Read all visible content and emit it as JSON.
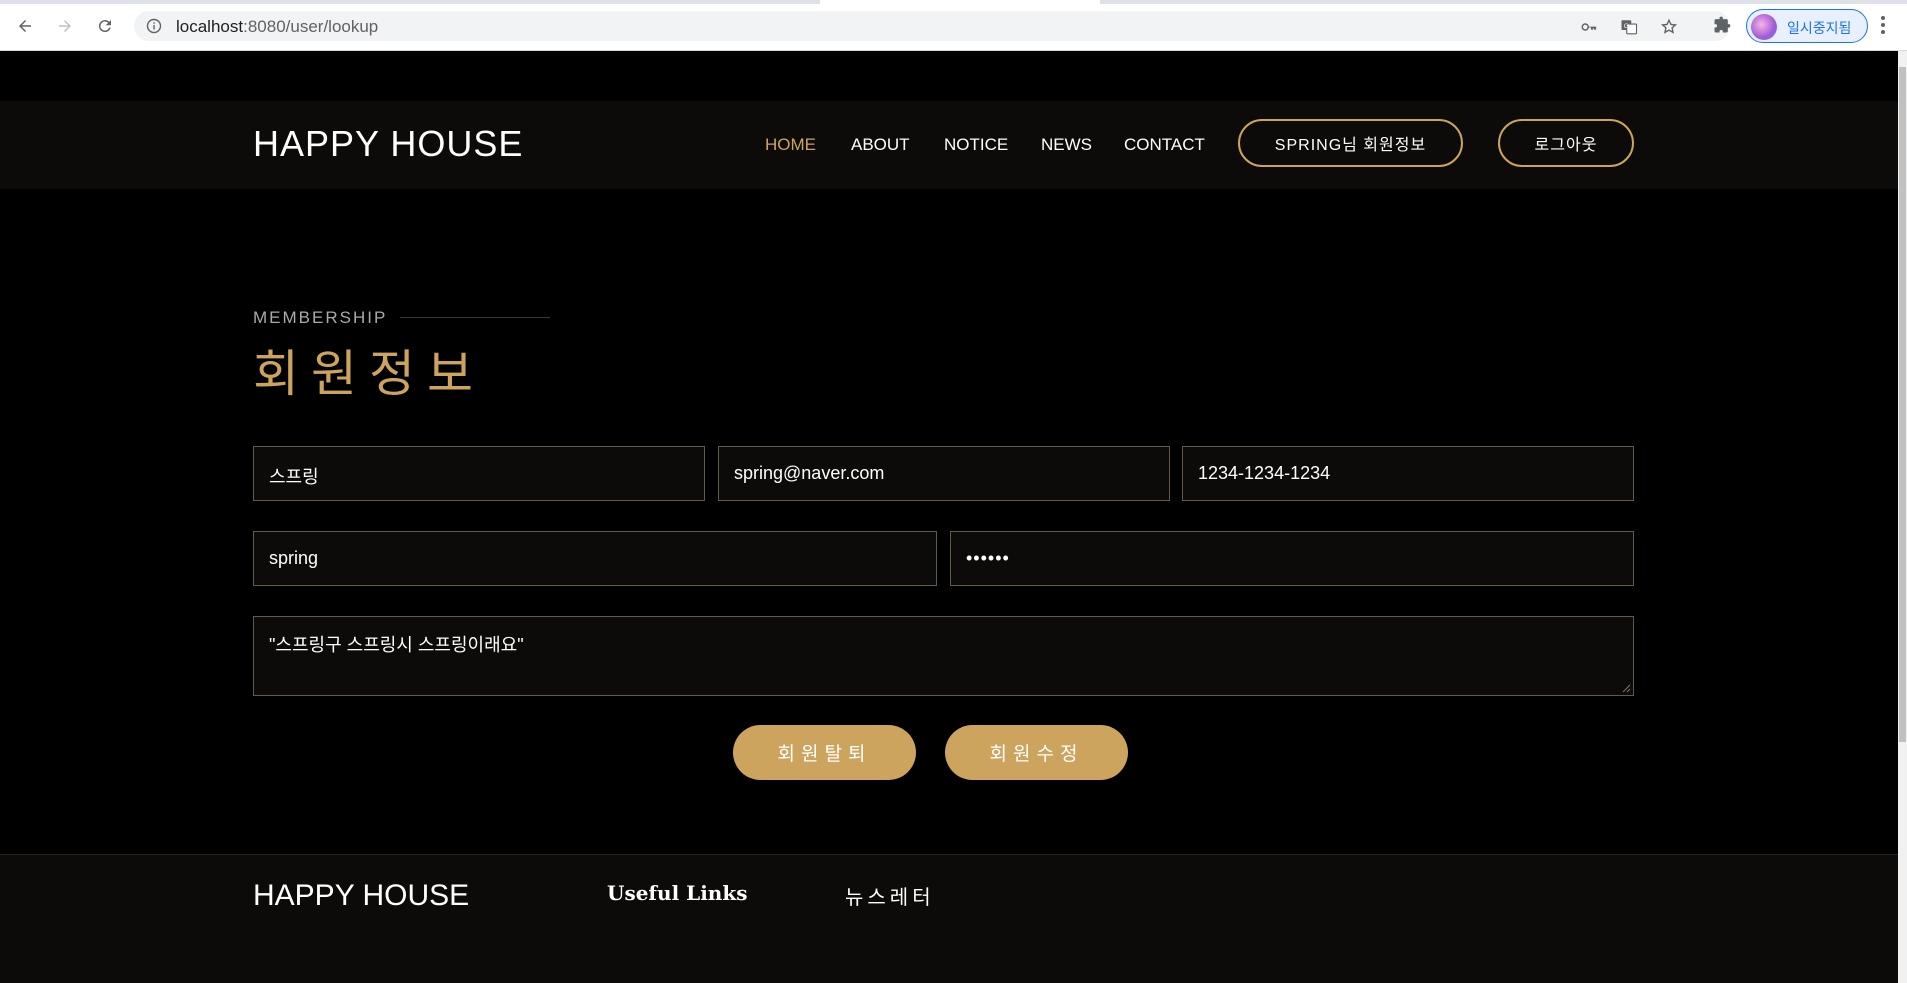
{
  "browser": {
    "url_host": "localhost",
    "url_path": ":8080/user/lookup",
    "profile_label": "일시중지됨"
  },
  "header": {
    "brand": "HAPPY HOUSE",
    "nav": [
      {
        "label": "HOME",
        "active": true
      },
      {
        "label": "ABOUT",
        "active": false
      },
      {
        "label": "NOTICE",
        "active": false
      },
      {
        "label": "NEWS",
        "active": false
      },
      {
        "label": "CONTACT",
        "active": false
      }
    ],
    "member_info_button": "SPRING님 회원정보",
    "logout_button": "로그아웃"
  },
  "section": {
    "kicker": "MEMBERSHIP",
    "title": "회원정보"
  },
  "form": {
    "name": "스프링",
    "email": "spring@naver.com",
    "phone": "1234-1234-1234",
    "user_id": "spring",
    "password": "••••••",
    "address": "\"스프링구 스프링시 스프링이래요\""
  },
  "actions": {
    "withdraw": "회원탈퇴",
    "update": "회원수정"
  },
  "footer": {
    "brand": "HAPPY HOUSE",
    "useful_links": "Useful Links",
    "newsletter": "뉴스레터"
  },
  "colors": {
    "accent": "#cda45e",
    "background": "#000000",
    "header_bg": "#0c0b09"
  }
}
